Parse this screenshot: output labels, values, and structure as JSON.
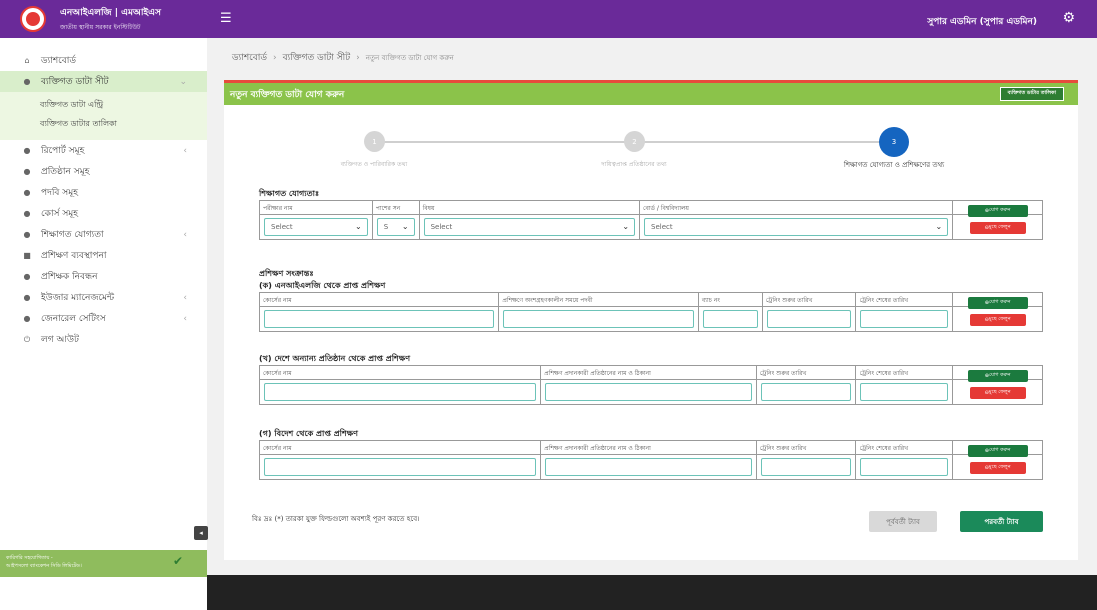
{
  "brand": {
    "title": "এনআইএলজি | এমআইএস",
    "subtitle": "জাতীয় স্থানীয় সরকার ইনস্টিটিউট"
  },
  "topbar": {
    "user": "সুপার এডমিন (সুপার এডমিন)",
    "menu_icon": "hamburger-icon",
    "settings_icon": "gear-icon"
  },
  "sidebar": {
    "items": [
      {
        "label": "ড্যাশবোর্ড",
        "icon": "home-icon"
      },
      {
        "label": "ব্যক্তিগত ডাটা সীট",
        "icon": "user-icon"
      },
      {
        "label": "রিপোর্ট সমূহ",
        "icon": "user-icon"
      },
      {
        "label": "প্রতিষ্ঠান সমূহ",
        "icon": "user-icon"
      },
      {
        "label": "পদবি সমূহ",
        "icon": "user-icon"
      },
      {
        "label": "কোর্স সমূহ",
        "icon": "user-icon"
      },
      {
        "label": "শিক্ষাগত যোগ্যতা",
        "icon": "user-icon"
      },
      {
        "label": "প্রশিক্ষণ ব্যবস্থাপনা",
        "icon": "book-icon"
      },
      {
        "label": "প্রশিক্ষক নিবন্ধন",
        "icon": "user-icon"
      },
      {
        "label": "ইউজার ম্যানেজমেন্ট",
        "icon": "user-icon"
      },
      {
        "label": "জেনারেল সেটিংস",
        "icon": "user-icon"
      },
      {
        "label": "লগ আউট",
        "icon": "power-icon"
      }
    ],
    "sub": [
      "ব্যক্তিগত ডাটা এন্ট্রি",
      "ব্যক্তিগত ডাটার তালিকা"
    ],
    "footer": [
      "কারিগরি সহযোগিতায় -",
      "আইপসলো ব্যাংকেশন সিডি লিমিটেড।"
    ]
  },
  "breadcrumb": {
    "home": "ড্যাশবোর্ড",
    "section": "ব্যক্তিগত ডাটা সীট",
    "current": "নতুন ব্যক্তিগত ডাটা যোগ করুন"
  },
  "panel": {
    "title": "নতুন ব্যক্তিগত ডাটা যোগ করুন",
    "list_button": "ব্যক্তিগত ডাটার তালিকা"
  },
  "steps": [
    {
      "num": "1",
      "label": "ব্যক্তিগত ও পারিবারিক তথ্য"
    },
    {
      "num": "2",
      "label": "দায়িত্বপ্রাপ্ত প্রতিষ্ঠানের তথ্য"
    },
    {
      "num": "3",
      "label": "শিক্ষাগত যোগ্যতা ও প্রশিক্ষণের তথ্য"
    }
  ],
  "education": {
    "title": "শিক্ষাগত যোগ্যতাঃ",
    "headers": [
      "পরীক্ষার নাম",
      "পাশের সন",
      "বিষয়",
      "বোর্ড / বিশ্ববিদ্যালয়"
    ],
    "selects": [
      "Select",
      "S",
      "Select",
      "Select"
    ]
  },
  "training": {
    "title": "প্রশিক্ষণ সংক্রান্তঃ",
    "a": {
      "title": "(ক) এনআইএলজি থেকে প্রাপ্ত প্রশিক্ষণ",
      "headers": [
        "কোর্সের নাম",
        "প্রশিক্ষণে অংশগ্রহণকালীন সময়ে পদবী",
        "ব্যাচ নং",
        "ট্রেনিং শুরুর তারিখ",
        "ট্রেনিং শেষের তারিখ"
      ]
    },
    "b": {
      "title": "(খ) দেশে অন্যান্য প্রতিষ্ঠান থেকে প্রাপ্ত প্রশিক্ষণ",
      "headers": [
        "কোর্সের নাম",
        "প্রশিক্ষণ প্রদানকারী প্রতিষ্ঠানের নাম ও ঠিকানা",
        "ট্রেনিং শুরুর তারিখ",
        "ট্রেনিং শেষের তারিখ"
      ]
    },
    "c": {
      "title": "(গ) বিদেশ থেকে প্রাপ্ত প্রশিক্ষণ",
      "headers": [
        "কোর্সের নাম",
        "প্রশিক্ষণ প্রদানকারী প্রতিষ্ঠানের নাম ও ঠিকানা",
        "ট্রেনিং শুরুর তারিখ",
        "ট্রেনিং শেষের তারিখ"
      ]
    }
  },
  "buttons": {
    "add": "যোগ করুন",
    "remove": "মুছে ফেলুন",
    "prev": "পূর্ববর্তী ট্যাব",
    "next": "পরবর্তী ট্যাব"
  },
  "note": "বিঃ দ্রঃ (*) তারকা যুক্ত ফিল্ডগুলো অবশ্যই পূরণ করতে হবে।",
  "colors": {
    "header": "#6a2a99",
    "panel_header": "#8bc34a",
    "active_step": "#1565c0",
    "add": "#1b7a3e",
    "remove": "#e53935"
  }
}
